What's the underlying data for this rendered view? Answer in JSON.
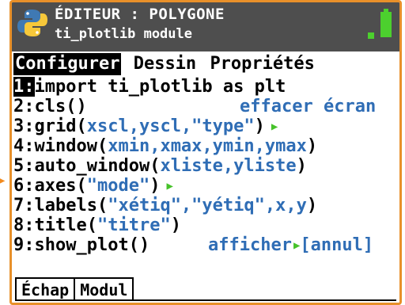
{
  "header": {
    "title": "ÉDITEUR : POLYGONE",
    "subtitle": "ti_plotlib module"
  },
  "tabs": [
    {
      "label": "Configurer"
    },
    {
      "label": "Dessin"
    },
    {
      "label": "Propriétés"
    }
  ],
  "items": [
    {
      "num": "1:",
      "parts": [
        "import ti_plotlib as plt"
      ]
    },
    {
      "num": "2:",
      "code": "cls()",
      "hint": "effacer écran"
    },
    {
      "num": "3:",
      "pre": "grid(",
      "args": "xscl,yscl,\"type\"",
      "post": ")"
    },
    {
      "num": "4:",
      "pre": "window(",
      "args": "xmin,xmax,ymin,ymax",
      "post": ")"
    },
    {
      "num": "5:",
      "pre": "auto_window(",
      "args": "xliste,yliste",
      "post": ")"
    },
    {
      "num": "6:",
      "pre": "axes(",
      "args": "\"mode\"",
      "post": ")"
    },
    {
      "num": "7:",
      "pre": "labels(",
      "args": "\"xétiq\",\"yétiq\",x,y",
      "post": ")"
    },
    {
      "num": "8:",
      "pre": "title(",
      "args": "\"titre\"",
      "post": ")"
    },
    {
      "num": "9:",
      "code": "show_plot()",
      "hint_a": "afficher",
      "hint_b": "[annul]"
    }
  ],
  "softkeys": [
    "Échap",
    "Modul"
  ],
  "colors": {
    "argument": "#2f6db5",
    "arrow": "#46c22a",
    "border": "#e8902a",
    "titlebar": "#4e4e4e",
    "battery": "#4cd02e"
  },
  "icons": [
    "python-icon",
    "battery-icon",
    "right-arrow-icon"
  ]
}
